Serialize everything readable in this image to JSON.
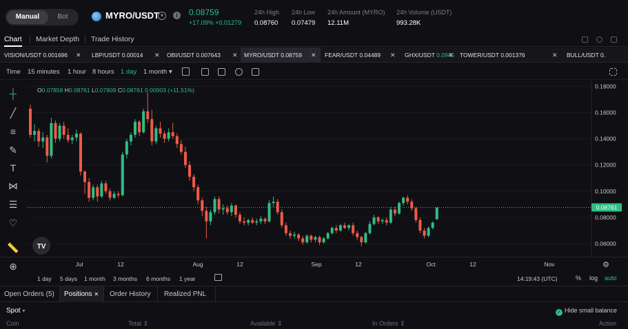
{
  "header": {
    "mode_manual": "Manual",
    "mode_bot": "Bot",
    "pair": "MYRO/USDT",
    "last_price": "0.08759",
    "change": "+17.09% +0.01279",
    "stats": [
      {
        "label": "24h High",
        "value": "0.08760"
      },
      {
        "label": "24h Low",
        "value": "0.07479"
      },
      {
        "label": "24h Amount (MYRO)",
        "value": "12.11M"
      },
      {
        "label": "24h Volume (USDT)",
        "value": "993.28K"
      }
    ]
  },
  "main_tabs": [
    "Chart",
    "Market Depth",
    "Trade History"
  ],
  "pair_tabs": [
    {
      "pair": "VISION/USDT",
      "price": "0.001696",
      "up": false
    },
    {
      "pair": "LBP/USDT",
      "price": "0.00014",
      "up": false
    },
    {
      "pair": "OBI/USDT",
      "price": "0.007643",
      "up": false
    },
    {
      "pair": "MYRO/USDT",
      "price": "0.08759",
      "up": false
    },
    {
      "pair": "FEAR/USDT",
      "price": "0.04489",
      "up": false
    },
    {
      "pair": "GHX/USDT",
      "price": "0.0945",
      "up": true
    },
    {
      "pair": "TOWER/USDT",
      "price": "0.001376",
      "up": false
    },
    {
      "pair": "BULL/USDT",
      "price": "0.",
      "up": false
    }
  ],
  "toolbar": {
    "time_label": "Time",
    "timeframes": [
      "15 minutes",
      "1 hour",
      "8 hours",
      "1 day",
      "1 month ▾"
    ],
    "active_timeframe": "1 day"
  },
  "legend": {
    "o_label": "O",
    "o": "0.07858",
    "h_label": "H",
    "h": "0.08761",
    "l_label": "L",
    "l": "0.07809",
    "c_label": "C",
    "c": "0.08761",
    "chg": "0.00903 (+11.51%)"
  },
  "bottom_timeframes": [
    "1 day",
    "5 days",
    "1 month",
    "3 months",
    "6 months",
    "1 year"
  ],
  "chart_time": "14:19:43 (UTC)",
  "scale_options": [
    "%",
    "log",
    "auto"
  ],
  "order_tabs": [
    "Open Orders (5)",
    "Positions",
    "Order History",
    "Realized PNL"
  ],
  "spot_select": "Spot",
  "hide_small": "Hide small balance",
  "columns": [
    "Coin",
    "Total",
    "Available",
    "In Orders",
    "Action"
  ],
  "colors": {
    "up": "#2fbd85",
    "down": "#f05a4a",
    "bg": "#101014"
  },
  "chart_data": {
    "type": "candlestick",
    "y_ticks": [
      "0.18000",
      "0.16000",
      "0.14000",
      "0.12000",
      "0.10000",
      "0.08000",
      "0.06000"
    ],
    "x_ticks": [
      "Jul",
      "12",
      "Aug",
      "12",
      "Sep",
      "12",
      "Oct",
      "12",
      "Nov"
    ],
    "current_price_label": "0.08761",
    "ylim": [
      0.05,
      0.185
    ],
    "candles": [
      {
        "o": 0.163,
        "h": 0.166,
        "l": 0.141,
        "c": 0.143
      },
      {
        "o": 0.143,
        "h": 0.151,
        "l": 0.138,
        "c": 0.146
      },
      {
        "o": 0.146,
        "h": 0.148,
        "l": 0.134,
        "c": 0.138
      },
      {
        "o": 0.138,
        "h": 0.145,
        "l": 0.133,
        "c": 0.141
      },
      {
        "o": 0.141,
        "h": 0.143,
        "l": 0.122,
        "c": 0.127
      },
      {
        "o": 0.127,
        "h": 0.156,
        "l": 0.125,
        "c": 0.152
      },
      {
        "o": 0.152,
        "h": 0.154,
        "l": 0.137,
        "c": 0.14
      },
      {
        "o": 0.14,
        "h": 0.152,
        "l": 0.138,
        "c": 0.15
      },
      {
        "o": 0.15,
        "h": 0.153,
        "l": 0.14,
        "c": 0.143
      },
      {
        "o": 0.143,
        "h": 0.148,
        "l": 0.137,
        "c": 0.139
      },
      {
        "o": 0.139,
        "h": 0.143,
        "l": 0.136,
        "c": 0.141
      },
      {
        "o": 0.141,
        "h": 0.147,
        "l": 0.138,
        "c": 0.144
      },
      {
        "o": 0.144,
        "h": 0.145,
        "l": 0.112,
        "c": 0.115
      },
      {
        "o": 0.115,
        "h": 0.116,
        "l": 0.098,
        "c": 0.107
      },
      {
        "o": 0.107,
        "h": 0.11,
        "l": 0.092,
        "c": 0.095
      },
      {
        "o": 0.095,
        "h": 0.105,
        "l": 0.093,
        "c": 0.103
      },
      {
        "o": 0.103,
        "h": 0.105,
        "l": 0.092,
        "c": 0.096
      },
      {
        "o": 0.096,
        "h": 0.108,
        "l": 0.095,
        "c": 0.106
      },
      {
        "o": 0.106,
        "h": 0.108,
        "l": 0.098,
        "c": 0.1
      },
      {
        "o": 0.1,
        "h": 0.102,
        "l": 0.093,
        "c": 0.095
      },
      {
        "o": 0.095,
        "h": 0.1,
        "l": 0.094,
        "c": 0.098
      },
      {
        "o": 0.098,
        "h": 0.1,
        "l": 0.095,
        "c": 0.097
      },
      {
        "o": 0.097,
        "h": 0.13,
        "l": 0.096,
        "c": 0.128
      },
      {
        "o": 0.128,
        "h": 0.14,
        "l": 0.125,
        "c": 0.138
      },
      {
        "o": 0.138,
        "h": 0.145,
        "l": 0.135,
        "c": 0.143
      },
      {
        "o": 0.143,
        "h": 0.155,
        "l": 0.141,
        "c": 0.153
      },
      {
        "o": 0.153,
        "h": 0.154,
        "l": 0.142,
        "c": 0.145
      },
      {
        "o": 0.145,
        "h": 0.163,
        "l": 0.144,
        "c": 0.161
      },
      {
        "o": 0.161,
        "h": 0.175,
        "l": 0.152,
        "c": 0.155
      },
      {
        "o": 0.155,
        "h": 0.162,
        "l": 0.135,
        "c": 0.138
      },
      {
        "o": 0.138,
        "h": 0.15,
        "l": 0.136,
        "c": 0.148
      },
      {
        "o": 0.148,
        "h": 0.153,
        "l": 0.141,
        "c": 0.144
      },
      {
        "o": 0.144,
        "h": 0.146,
        "l": 0.137,
        "c": 0.14
      },
      {
        "o": 0.14,
        "h": 0.148,
        "l": 0.138,
        "c": 0.145
      },
      {
        "o": 0.145,
        "h": 0.152,
        "l": 0.14,
        "c": 0.142
      },
      {
        "o": 0.142,
        "h": 0.144,
        "l": 0.133,
        "c": 0.136
      },
      {
        "o": 0.136,
        "h": 0.139,
        "l": 0.128,
        "c": 0.13
      },
      {
        "o": 0.13,
        "h": 0.134,
        "l": 0.118,
        "c": 0.12
      },
      {
        "o": 0.12,
        "h": 0.123,
        "l": 0.108,
        "c": 0.111
      },
      {
        "o": 0.111,
        "h": 0.113,
        "l": 0.1,
        "c": 0.103
      },
      {
        "o": 0.103,
        "h": 0.105,
        "l": 0.09,
        "c": 0.093
      },
      {
        "o": 0.093,
        "h": 0.095,
        "l": 0.081,
        "c": 0.085
      },
      {
        "o": 0.085,
        "h": 0.088,
        "l": 0.064,
        "c": 0.077
      },
      {
        "o": 0.077,
        "h": 0.086,
        "l": 0.074,
        "c": 0.084
      },
      {
        "o": 0.084,
        "h": 0.096,
        "l": 0.082,
        "c": 0.094
      },
      {
        "o": 0.094,
        "h": 0.096,
        "l": 0.083,
        "c": 0.086
      },
      {
        "o": 0.086,
        "h": 0.09,
        "l": 0.082,
        "c": 0.087
      },
      {
        "o": 0.087,
        "h": 0.089,
        "l": 0.082,
        "c": 0.084
      },
      {
        "o": 0.084,
        "h": 0.091,
        "l": 0.081,
        "c": 0.089
      },
      {
        "o": 0.089,
        "h": 0.09,
        "l": 0.08,
        "c": 0.082
      },
      {
        "o": 0.082,
        "h": 0.084,
        "l": 0.075,
        "c": 0.077
      },
      {
        "o": 0.077,
        "h": 0.08,
        "l": 0.074,
        "c": 0.076
      },
      {
        "o": 0.076,
        "h": 0.079,
        "l": 0.074,
        "c": 0.078
      },
      {
        "o": 0.078,
        "h": 0.08,
        "l": 0.075,
        "c": 0.076
      },
      {
        "o": 0.076,
        "h": 0.079,
        "l": 0.074,
        "c": 0.077
      },
      {
        "o": 0.077,
        "h": 0.081,
        "l": 0.075,
        "c": 0.079
      },
      {
        "o": 0.079,
        "h": 0.08,
        "l": 0.075,
        "c": 0.077
      },
      {
        "o": 0.077,
        "h": 0.093,
        "l": 0.076,
        "c": 0.091
      },
      {
        "o": 0.091,
        "h": 0.096,
        "l": 0.088,
        "c": 0.092
      },
      {
        "o": 0.092,
        "h": 0.094,
        "l": 0.082,
        "c": 0.084
      },
      {
        "o": 0.084,
        "h": 0.086,
        "l": 0.072,
        "c": 0.074
      },
      {
        "o": 0.074,
        "h": 0.076,
        "l": 0.066,
        "c": 0.068
      },
      {
        "o": 0.068,
        "h": 0.07,
        "l": 0.064,
        "c": 0.066
      },
      {
        "o": 0.066,
        "h": 0.069,
        "l": 0.064,
        "c": 0.067
      },
      {
        "o": 0.067,
        "h": 0.068,
        "l": 0.062,
        "c": 0.064
      },
      {
        "o": 0.064,
        "h": 0.066,
        "l": 0.059,
        "c": 0.061
      },
      {
        "o": 0.061,
        "h": 0.067,
        "l": 0.06,
        "c": 0.066
      },
      {
        "o": 0.066,
        "h": 0.067,
        "l": 0.061,
        "c": 0.063
      },
      {
        "o": 0.063,
        "h": 0.066,
        "l": 0.061,
        "c": 0.065
      },
      {
        "o": 0.065,
        "h": 0.066,
        "l": 0.059,
        "c": 0.061
      },
      {
        "o": 0.061,
        "h": 0.065,
        "l": 0.06,
        "c": 0.064
      },
      {
        "o": 0.064,
        "h": 0.069,
        "l": 0.063,
        "c": 0.068
      },
      {
        "o": 0.068,
        "h": 0.073,
        "l": 0.067,
        "c": 0.072
      },
      {
        "o": 0.072,
        "h": 0.074,
        "l": 0.068,
        "c": 0.07
      },
      {
        "o": 0.07,
        "h": 0.075,
        "l": 0.069,
        "c": 0.074
      },
      {
        "o": 0.074,
        "h": 0.076,
        "l": 0.071,
        "c": 0.072
      },
      {
        "o": 0.072,
        "h": 0.075,
        "l": 0.07,
        "c": 0.074
      },
      {
        "o": 0.074,
        "h": 0.076,
        "l": 0.066,
        "c": 0.068
      },
      {
        "o": 0.068,
        "h": 0.07,
        "l": 0.063,
        "c": 0.065
      },
      {
        "o": 0.065,
        "h": 0.066,
        "l": 0.058,
        "c": 0.061
      },
      {
        "o": 0.061,
        "h": 0.069,
        "l": 0.06,
        "c": 0.068
      },
      {
        "o": 0.068,
        "h": 0.077,
        "l": 0.067,
        "c": 0.075
      },
      {
        "o": 0.075,
        "h": 0.082,
        "l": 0.074,
        "c": 0.08
      },
      {
        "o": 0.08,
        "h": 0.081,
        "l": 0.075,
        "c": 0.077
      },
      {
        "o": 0.077,
        "h": 0.079,
        "l": 0.075,
        "c": 0.078
      },
      {
        "o": 0.078,
        "h": 0.08,
        "l": 0.074,
        "c": 0.076
      },
      {
        "o": 0.076,
        "h": 0.088,
        "l": 0.075,
        "c": 0.086
      },
      {
        "o": 0.086,
        "h": 0.088,
        "l": 0.081,
        "c": 0.083
      },
      {
        "o": 0.083,
        "h": 0.092,
        "l": 0.082,
        "c": 0.091
      },
      {
        "o": 0.091,
        "h": 0.096,
        "l": 0.089,
        "c": 0.095
      },
      {
        "o": 0.095,
        "h": 0.097,
        "l": 0.09,
        "c": 0.092
      },
      {
        "o": 0.092,
        "h": 0.094,
        "l": 0.085,
        "c": 0.087
      },
      {
        "o": 0.087,
        "h": 0.088,
        "l": 0.076,
        "c": 0.078
      },
      {
        "o": 0.078,
        "h": 0.08,
        "l": 0.068,
        "c": 0.07
      },
      {
        "o": 0.07,
        "h": 0.072,
        "l": 0.064,
        "c": 0.066
      },
      {
        "o": 0.066,
        "h": 0.073,
        "l": 0.065,
        "c": 0.072
      },
      {
        "o": 0.072,
        "h": 0.077,
        "l": 0.071,
        "c": 0.076
      },
      {
        "o": 0.07858,
        "h": 0.08761,
        "l": 0.07809,
        "c": 0.08761
      }
    ]
  }
}
